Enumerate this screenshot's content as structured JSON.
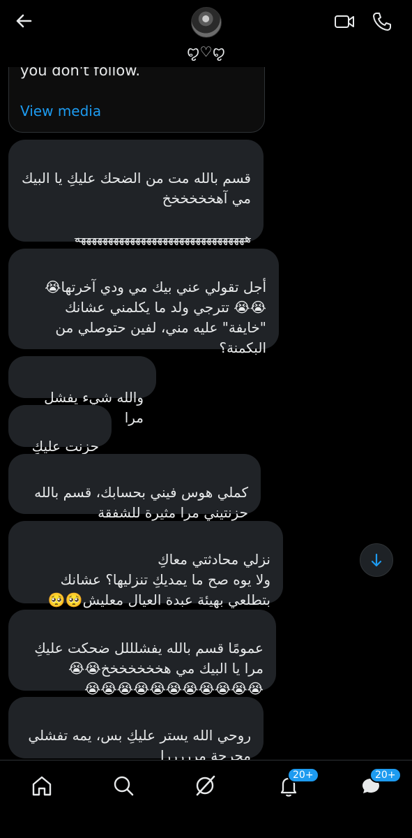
{
  "header": {
    "name": "ꨄ♡ꨄ",
    "back_icon": "back-arrow-icon",
    "video_icon": "video-call-icon",
    "phone_icon": "phone-call-icon"
  },
  "media_card": {
    "text": "you don't follow.",
    "link": "View media"
  },
  "messages": [
    {
      "text": "قسم بالله مت من الضحك عليكِ يا البيك مي آهخخخخخخ"
    },
    {
      "strike": "هههههههههههههههههههههههههههههههه",
      "tail": "ه"
    },
    {
      "text": "أجل تقولي عني بيك مي ودي آخرتها😭\n😭😭 تترجي ولد ما يكلمني عشانك \"خايفة\" عليه مني، لفين حتوصلي من البكمنة؟"
    },
    {
      "text": "والله شيء يفشل مرا"
    },
    {
      "text": "حزنت عليكِ"
    },
    {
      "text": "كملي هوس فيني بحسابك، قسم بالله حزنتيني مرا مثيرة للشفقة"
    },
    {
      "text": "نزلي محادثتي معاكِ\nولا يوه صح ما يمديكِ تنزليها؟ عشانك بتطلعي بهيئة عبدة العيال معليش🥺🥺"
    },
    {
      "text": "عمومًا قسم بالله يفشلللل ضحكت عليكِ مرا يا البيك مي هخخخخخخخ😭😭\n😭😭😭😭😭😭😭😭😭😭😭"
    },
    {
      "text": "روحي الله يستر عليكِ بس، يمه تفشلي محرجة مرررررا"
    }
  ],
  "scroll_icon": "arrow-down-icon",
  "nav": {
    "home_icon": "home-icon",
    "search_icon": "search-icon",
    "grok_icon": "grok-icon",
    "notifications_badge": "20+",
    "messages_badge": "20+"
  },
  "colors": {
    "accent": "#1d9bf0",
    "bubble": "#202327",
    "background": "#000000"
  }
}
